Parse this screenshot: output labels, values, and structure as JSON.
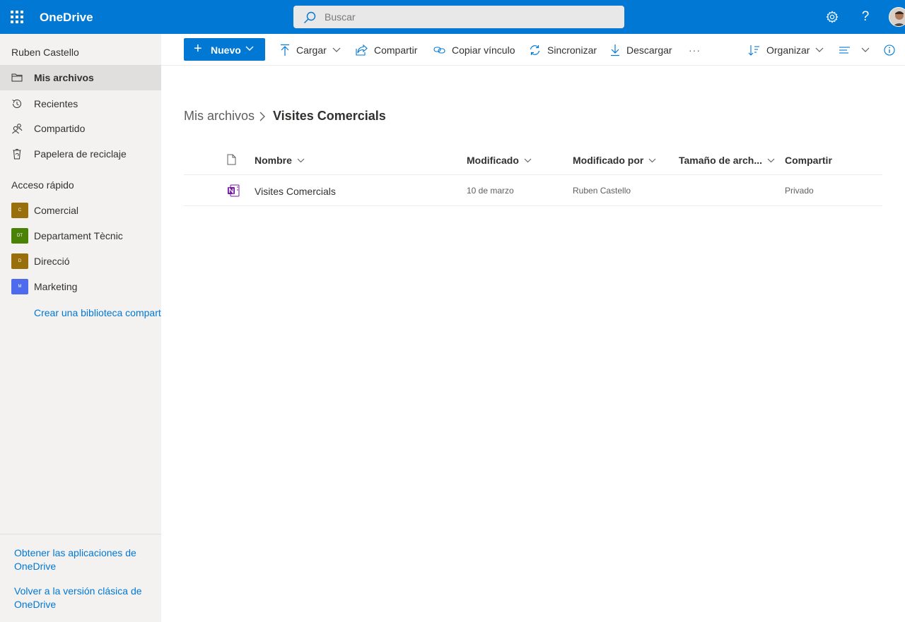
{
  "topbar": {
    "app_name": "OneDrive",
    "search_placeholder": "Buscar",
    "settings_icon": "gear-icon",
    "help_icon": "?"
  },
  "sidebar": {
    "user_name": "Ruben Castello",
    "nav": [
      {
        "label": "Mis archivos",
        "icon": "folder-icon",
        "active": true
      },
      {
        "label": "Recientes",
        "icon": "history-icon"
      },
      {
        "label": "Compartido",
        "icon": "people-icon"
      },
      {
        "label": "Papelera de reciclaje",
        "icon": "recycle-bin-icon"
      }
    ],
    "quick_access_title": "Acceso rápido",
    "libraries": [
      {
        "label": "Comercial",
        "badge": "C",
        "color": "#986f0b"
      },
      {
        "label": "Departament Tècnic",
        "badge": "DT",
        "color": "#498205"
      },
      {
        "label": "Direcció",
        "badge": "D",
        "color": "#986f0b"
      },
      {
        "label": "Marketing",
        "badge": "M",
        "color": "#4f6bed"
      }
    ],
    "create_library_link": "Crear una biblioteca compartida",
    "get_apps_link": "Obtener las aplicaciones de OneDrive",
    "classic_link": "Volver a la versión clásica de OneDrive"
  },
  "commandbar": {
    "new_label": "Nuevo",
    "upload_label": "Cargar",
    "share_label": "Compartir",
    "copy_link_label": "Copiar vínculo",
    "sync_label": "Sincronizar",
    "download_label": "Descargar",
    "more_label": "···",
    "sort_label": "Organizar"
  },
  "breadcrumb": {
    "root": "Mis archivos",
    "current": "Visites Comercials"
  },
  "list": {
    "columns": {
      "name": "Nombre",
      "modified": "Modificado",
      "modified_by": "Modificado por",
      "size": "Tamaño de arch...",
      "sharing": "Compartir"
    },
    "rows": [
      {
        "name": "Visites Comercials",
        "type_icon": "onenote-icon",
        "modified": "10 de marzo",
        "modified_by": "Ruben Castello",
        "size": "",
        "sharing": "Privado"
      }
    ]
  },
  "colors": {
    "brand": "#0078d4",
    "sidebar_bg": "#f3f2f1",
    "onenote": "#7719aa"
  }
}
